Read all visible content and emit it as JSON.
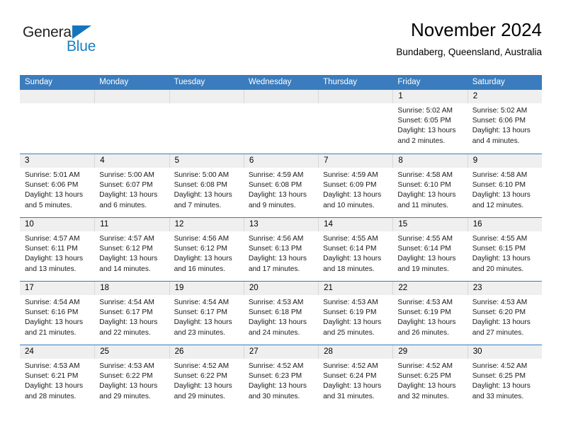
{
  "brand": {
    "name_part1": "General",
    "name_part2": "Blue",
    "triangle_icon": "triangle-icon",
    "color_dark": "#231f20",
    "color_blue": "#1b80c4"
  },
  "header": {
    "title": "November 2024",
    "location": "Bundaberg, Queensland, Australia"
  },
  "theme": {
    "header_blue": "#3a7cbd",
    "day_band_gray": "#efefef"
  },
  "weekdays": [
    "Sunday",
    "Monday",
    "Tuesday",
    "Wednesday",
    "Thursday",
    "Friday",
    "Saturday"
  ],
  "weeks": [
    {
      "days": [
        {
          "num": "",
          "empty": true
        },
        {
          "num": "",
          "empty": true
        },
        {
          "num": "",
          "empty": true
        },
        {
          "num": "",
          "empty": true
        },
        {
          "num": "",
          "empty": true
        },
        {
          "num": "1",
          "sunrise": "Sunrise: 5:02 AM",
          "sunset": "Sunset: 6:05 PM",
          "daylight1": "Daylight: 13 hours",
          "daylight2": "and 2 minutes."
        },
        {
          "num": "2",
          "sunrise": "Sunrise: 5:02 AM",
          "sunset": "Sunset: 6:06 PM",
          "daylight1": "Daylight: 13 hours",
          "daylight2": "and 4 minutes."
        }
      ]
    },
    {
      "days": [
        {
          "num": "3",
          "sunrise": "Sunrise: 5:01 AM",
          "sunset": "Sunset: 6:06 PM",
          "daylight1": "Daylight: 13 hours",
          "daylight2": "and 5 minutes."
        },
        {
          "num": "4",
          "sunrise": "Sunrise: 5:00 AM",
          "sunset": "Sunset: 6:07 PM",
          "daylight1": "Daylight: 13 hours",
          "daylight2": "and 6 minutes."
        },
        {
          "num": "5",
          "sunrise": "Sunrise: 5:00 AM",
          "sunset": "Sunset: 6:08 PM",
          "daylight1": "Daylight: 13 hours",
          "daylight2": "and 7 minutes."
        },
        {
          "num": "6",
          "sunrise": "Sunrise: 4:59 AM",
          "sunset": "Sunset: 6:08 PM",
          "daylight1": "Daylight: 13 hours",
          "daylight2": "and 9 minutes."
        },
        {
          "num": "7",
          "sunrise": "Sunrise: 4:59 AM",
          "sunset": "Sunset: 6:09 PM",
          "daylight1": "Daylight: 13 hours",
          "daylight2": "and 10 minutes."
        },
        {
          "num": "8",
          "sunrise": "Sunrise: 4:58 AM",
          "sunset": "Sunset: 6:10 PM",
          "daylight1": "Daylight: 13 hours",
          "daylight2": "and 11 minutes."
        },
        {
          "num": "9",
          "sunrise": "Sunrise: 4:58 AM",
          "sunset": "Sunset: 6:10 PM",
          "daylight1": "Daylight: 13 hours",
          "daylight2": "and 12 minutes."
        }
      ]
    },
    {
      "days": [
        {
          "num": "10",
          "sunrise": "Sunrise: 4:57 AM",
          "sunset": "Sunset: 6:11 PM",
          "daylight1": "Daylight: 13 hours",
          "daylight2": "and 13 minutes."
        },
        {
          "num": "11",
          "sunrise": "Sunrise: 4:57 AM",
          "sunset": "Sunset: 6:12 PM",
          "daylight1": "Daylight: 13 hours",
          "daylight2": "and 14 minutes."
        },
        {
          "num": "12",
          "sunrise": "Sunrise: 4:56 AM",
          "sunset": "Sunset: 6:12 PM",
          "daylight1": "Daylight: 13 hours",
          "daylight2": "and 16 minutes."
        },
        {
          "num": "13",
          "sunrise": "Sunrise: 4:56 AM",
          "sunset": "Sunset: 6:13 PM",
          "daylight1": "Daylight: 13 hours",
          "daylight2": "and 17 minutes."
        },
        {
          "num": "14",
          "sunrise": "Sunrise: 4:55 AM",
          "sunset": "Sunset: 6:14 PM",
          "daylight1": "Daylight: 13 hours",
          "daylight2": "and 18 minutes."
        },
        {
          "num": "15",
          "sunrise": "Sunrise: 4:55 AM",
          "sunset": "Sunset: 6:14 PM",
          "daylight1": "Daylight: 13 hours",
          "daylight2": "and 19 minutes."
        },
        {
          "num": "16",
          "sunrise": "Sunrise: 4:55 AM",
          "sunset": "Sunset: 6:15 PM",
          "daylight1": "Daylight: 13 hours",
          "daylight2": "and 20 minutes."
        }
      ]
    },
    {
      "days": [
        {
          "num": "17",
          "sunrise": "Sunrise: 4:54 AM",
          "sunset": "Sunset: 6:16 PM",
          "daylight1": "Daylight: 13 hours",
          "daylight2": "and 21 minutes."
        },
        {
          "num": "18",
          "sunrise": "Sunrise: 4:54 AM",
          "sunset": "Sunset: 6:17 PM",
          "daylight1": "Daylight: 13 hours",
          "daylight2": "and 22 minutes."
        },
        {
          "num": "19",
          "sunrise": "Sunrise: 4:54 AM",
          "sunset": "Sunset: 6:17 PM",
          "daylight1": "Daylight: 13 hours",
          "daylight2": "and 23 minutes."
        },
        {
          "num": "20",
          "sunrise": "Sunrise: 4:53 AM",
          "sunset": "Sunset: 6:18 PM",
          "daylight1": "Daylight: 13 hours",
          "daylight2": "and 24 minutes."
        },
        {
          "num": "21",
          "sunrise": "Sunrise: 4:53 AM",
          "sunset": "Sunset: 6:19 PM",
          "daylight1": "Daylight: 13 hours",
          "daylight2": "and 25 minutes."
        },
        {
          "num": "22",
          "sunrise": "Sunrise: 4:53 AM",
          "sunset": "Sunset: 6:19 PM",
          "daylight1": "Daylight: 13 hours",
          "daylight2": "and 26 minutes."
        },
        {
          "num": "23",
          "sunrise": "Sunrise: 4:53 AM",
          "sunset": "Sunset: 6:20 PM",
          "daylight1": "Daylight: 13 hours",
          "daylight2": "and 27 minutes."
        }
      ]
    },
    {
      "days": [
        {
          "num": "24",
          "sunrise": "Sunrise: 4:53 AM",
          "sunset": "Sunset: 6:21 PM",
          "daylight1": "Daylight: 13 hours",
          "daylight2": "and 28 minutes."
        },
        {
          "num": "25",
          "sunrise": "Sunrise: 4:53 AM",
          "sunset": "Sunset: 6:22 PM",
          "daylight1": "Daylight: 13 hours",
          "daylight2": "and 29 minutes."
        },
        {
          "num": "26",
          "sunrise": "Sunrise: 4:52 AM",
          "sunset": "Sunset: 6:22 PM",
          "daylight1": "Daylight: 13 hours",
          "daylight2": "and 29 minutes."
        },
        {
          "num": "27",
          "sunrise": "Sunrise: 4:52 AM",
          "sunset": "Sunset: 6:23 PM",
          "daylight1": "Daylight: 13 hours",
          "daylight2": "and 30 minutes."
        },
        {
          "num": "28",
          "sunrise": "Sunrise: 4:52 AM",
          "sunset": "Sunset: 6:24 PM",
          "daylight1": "Daylight: 13 hours",
          "daylight2": "and 31 minutes."
        },
        {
          "num": "29",
          "sunrise": "Sunrise: 4:52 AM",
          "sunset": "Sunset: 6:25 PM",
          "daylight1": "Daylight: 13 hours",
          "daylight2": "and 32 minutes."
        },
        {
          "num": "30",
          "sunrise": "Sunrise: 4:52 AM",
          "sunset": "Sunset: 6:25 PM",
          "daylight1": "Daylight: 13 hours",
          "daylight2": "and 33 minutes."
        }
      ]
    }
  ]
}
